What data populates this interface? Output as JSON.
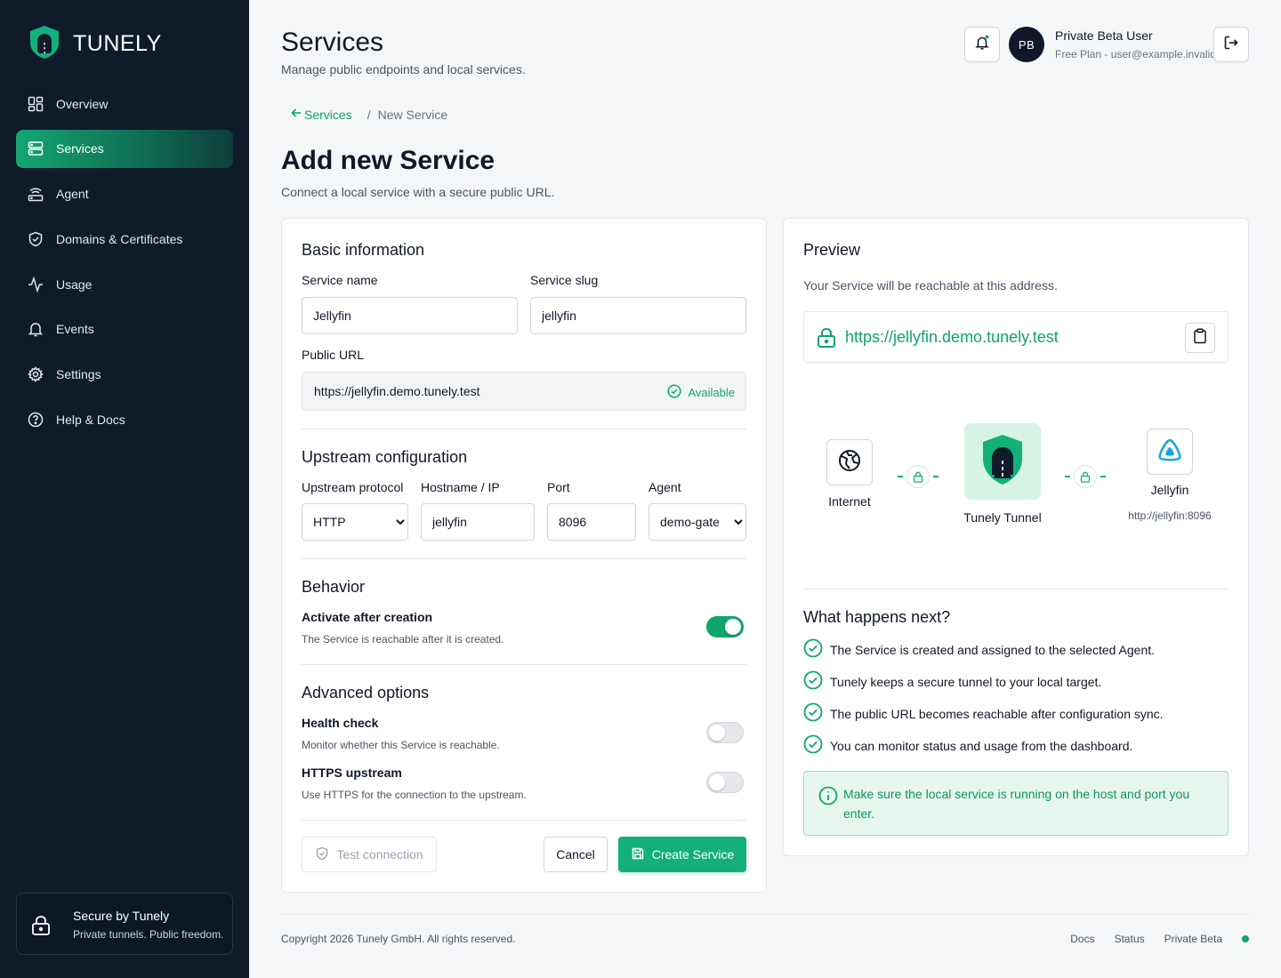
{
  "brand": {
    "name": "TUNELY"
  },
  "sidebar": {
    "items": [
      {
        "label": "Overview",
        "icon": "dashboard-icon"
      },
      {
        "label": "Services",
        "icon": "server-icon",
        "active": true
      },
      {
        "label": "Agent",
        "icon": "router-icon"
      },
      {
        "label": "Domains & Certificates",
        "icon": "shield-check-icon"
      },
      {
        "label": "Usage",
        "icon": "activity-icon"
      },
      {
        "label": "Events",
        "icon": "bell-icon"
      },
      {
        "label": "Settings",
        "icon": "gear-icon"
      },
      {
        "label": "Help & Docs",
        "icon": "help-circle-icon"
      }
    ],
    "secure_title": "Secure by Tunely",
    "secure_sub": "Private tunnels. Public freedom."
  },
  "header": {
    "title": "Services",
    "subtitle": "Manage public endpoints and local services.",
    "avatar_initials": "PB",
    "user_name": "Private Beta User",
    "user_plan": "Free Plan - user@example.invalid"
  },
  "breadcrumb": {
    "parent": "Services",
    "current": "New Service"
  },
  "page": {
    "title": "Add new Service",
    "subtitle": "Connect a local service with a secure public URL."
  },
  "form": {
    "basic_title": "Basic information",
    "service_name_label": "Service name",
    "service_name_value": "Jellyfin",
    "service_slug_label": "Service slug",
    "service_slug_value": "jellyfin",
    "public_url_label": "Public URL",
    "public_url_value": "https://jellyfin.demo.tunely.test",
    "availability": "Available",
    "upstream_title": "Upstream configuration",
    "protocol_label": "Upstream protocol",
    "protocol_value": "HTTP",
    "hostname_label": "Hostname / IP",
    "hostname_value": "jellyfin",
    "port_label": "Port",
    "port_value": "8096",
    "agent_label": "Agent",
    "agent_value": "demo-gate",
    "behavior_title": "Behavior",
    "activate_label": "Activate after creation",
    "activate_help": "The Service is reachable after it is created.",
    "activate_on": true,
    "advanced_title": "Advanced options",
    "health_label": "Health check",
    "health_help": "Monitor whether this Service is reachable.",
    "health_on": false,
    "https_label": "HTTPS upstream",
    "https_help": "Use HTTPS for the connection to the upstream.",
    "https_on": false,
    "test_button": "Test connection",
    "cancel_button": "Cancel",
    "create_button": "Create Service"
  },
  "preview": {
    "title": "Preview",
    "subtitle": "Your Service will be reachable at this address.",
    "url": "https://jellyfin.demo.tunely.test",
    "nodes": {
      "internet": "Internet",
      "tunnel": "Tunely Tunnel",
      "service": "Jellyfin",
      "service_address": "http://jellyfin:8096"
    },
    "next_title": "What happens next?",
    "steps": [
      "The Service is created and assigned to the selected Agent.",
      "Tunely keeps a secure tunnel to your local target.",
      "The public URL becomes reachable after configuration sync.",
      "You can monitor status and usage from the dashboard."
    ],
    "info": "Make sure the local service is running on the host and port you enter."
  },
  "footer": {
    "copyright": "Copyright 2026 Tunely GmbH. All rights reserved.",
    "links": [
      "Docs",
      "Status",
      "Private Beta"
    ]
  },
  "colors": {
    "accent": "#14b07a",
    "sidebar_bg": "#0f1b2b",
    "status_dot": "#10a56b"
  }
}
